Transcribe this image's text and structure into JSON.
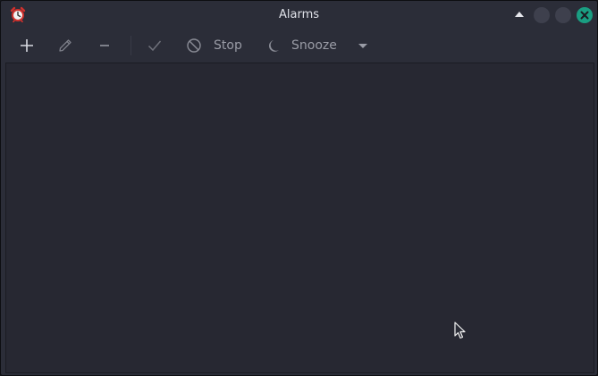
{
  "window": {
    "title": "Alarms",
    "accent": "#1a9e82"
  },
  "titlebar_buttons": {
    "up_icon": "triangle-up-icon",
    "minimize_icon": "circle-icon",
    "maximize_icon": "circle-icon",
    "close_icon": "close-icon"
  },
  "toolbar": {
    "new_icon": "plus-icon",
    "edit_icon": "pencil-icon",
    "delete_icon": "minus-icon",
    "acknowledge_icon": "checkmark-icon",
    "stop_icon": "forbidden-icon",
    "stop_label": "Stop",
    "snooze_icon": "moon-icon",
    "snooze_label": "Snooze",
    "snooze_menu_icon": "triangle-down-icon"
  },
  "alarm_list": {
    "items": []
  }
}
